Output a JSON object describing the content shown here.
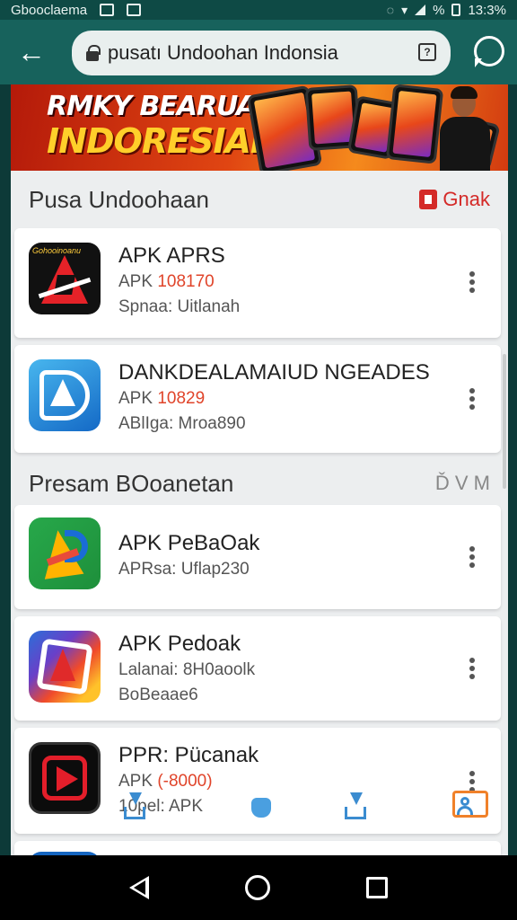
{
  "status_bar": {
    "left_text": "Gbooclaema",
    "battery_text": "%",
    "time": "13:3%"
  },
  "toolbar": {
    "url_text": "pusatı Undoohan Indonsia",
    "url_badge": "?"
  },
  "banner": {
    "line1": "RMKY BEARUAIN",
    "line2": "INDORESIAI"
  },
  "section1": {
    "title": "Pusa Undoohaan",
    "action_label": "Gnak"
  },
  "section2": {
    "title": "Presam BOoanetan",
    "action_label": "Ď V М"
  },
  "apps": [
    {
      "icon_label": "Gohooinoanu",
      "name": "APK APRS",
      "line1_prefix": "APK ",
      "line1_highlight": "108170",
      "line2": "Spnaa: Uitlanah"
    },
    {
      "name": "DANKDEALAMAIUD NGEADES",
      "line1_prefix": "APK ",
      "line1_highlight": "10829",
      "line2": "ABlIga: Mroa890"
    },
    {
      "name": "APK PeBaOak",
      "line1": "APRsa: Uflap230"
    },
    {
      "name": "APK Pedoak",
      "line1": "Lalanai: 8H0aoolk",
      "line2": "BoBeaae6"
    },
    {
      "name": "PPR: Pücanak",
      "line1_prefix": "APK ",
      "line1_highlight": "(-8000)",
      "line2": "10pel: APK"
    }
  ],
  "colors": {
    "toolbar": "#17625c",
    "status_bar": "#0e4a45",
    "accent": "#d42a28",
    "highlight": "#e0442a"
  }
}
